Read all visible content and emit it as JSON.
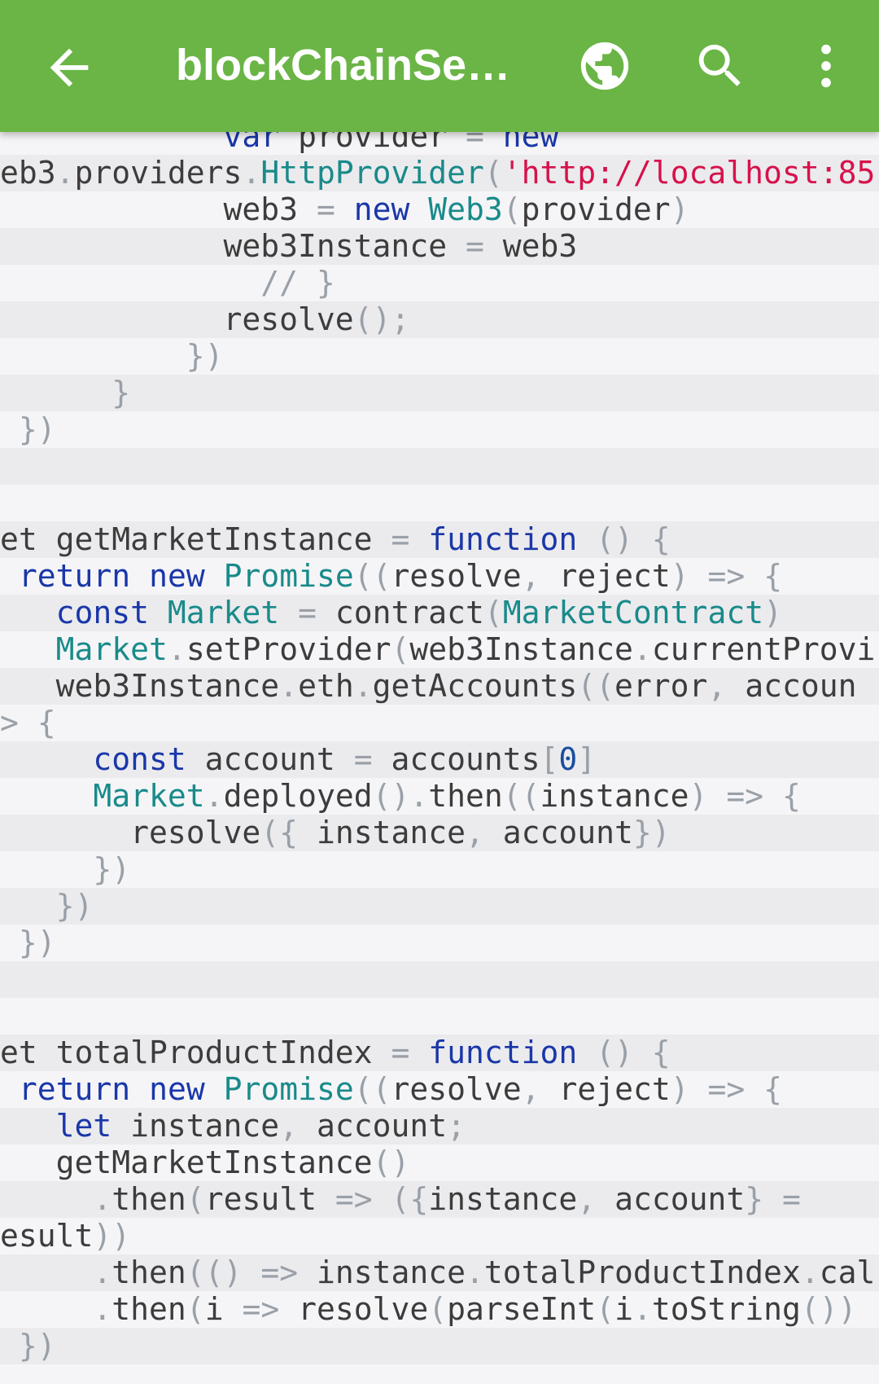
{
  "app_bar": {
    "title": "blockChainSer…",
    "icons": [
      "arrow-back-icon",
      "globe-icon",
      "search-icon",
      "more-vert-icon"
    ]
  },
  "colors": {
    "app_bar": "#6ab545",
    "keyword": "#1a37a8",
    "type": "#1a8a8a",
    "string": "#d6124b",
    "punctuation": "#9aa0a8"
  },
  "code": {
    "lines": [
      "            var provider = new",
      "eb3.providers.HttpProvider('http://localhost:85",
      "            web3 = new Web3(provider)",
      "            web3Instance = web3",
      "              // }",
      "            resolve();",
      "          })",
      "      }",
      " })",
      "",
      "",
      "et getMarketInstance = function () {",
      " return new Promise((resolve, reject) => {",
      "   const Market = contract(MarketContract)",
      "   Market.setProvider(web3Instance.currentProvi",
      "   web3Instance.eth.getAccounts((error, accoun",
      "> {",
      "     const account = accounts[0]",
      "     Market.deployed().then((instance) => {",
      "       resolve({ instance, account})",
      "     })",
      "   })",
      " })",
      "",
      "",
      "et totalProductIndex = function () {",
      " return new Promise((resolve, reject) => {",
      "   let instance, account;",
      "   getMarketInstance()",
      "     .then(result => ({instance, account} =",
      "esult))",
      "     .then(() => instance.totalProductIndex.cal",
      "     .then(i => resolve(parseInt(i.toString())",
      " })",
      ""
    ]
  }
}
